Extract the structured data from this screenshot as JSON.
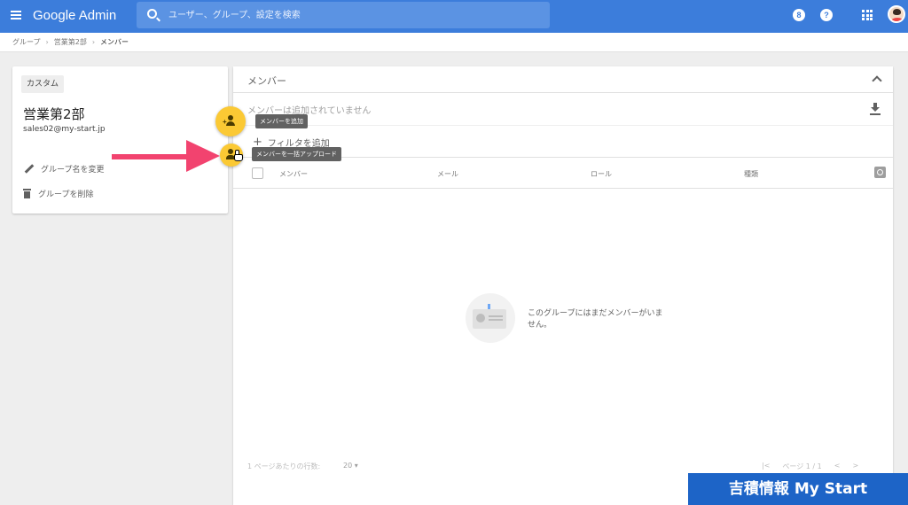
{
  "topbar": {
    "app_title": "Google Admin",
    "search_placeholder": "ユーザー、グループ、設定を検索",
    "support_badge": "8",
    "help_label": "?"
  },
  "breadcrumb": [
    "グループ",
    "営業第2部",
    "メンバー"
  ],
  "group": {
    "chip": "カスタム",
    "name": "営業第2部",
    "email": "sales02@my-start.jp",
    "rename_label": "グループ名を変更",
    "delete_label": "グループを削除"
  },
  "fabs": {
    "add_tooltip": "メンバーを追加",
    "upload_tooltip": "メンバーを一括アップロード"
  },
  "panel": {
    "title": "メンバー",
    "empty_note": "メンバーは追加されていません",
    "add_filter": "フィルタを追加",
    "columns": [
      "メンバー",
      "メール",
      "ロール",
      "種類"
    ],
    "empty_message": "このグループにはまだメンバーがいません。",
    "rows_per_page_label": "1 ページあたりの行数:",
    "rows_per_page_value": "20 ▾",
    "first_page": "|<",
    "page_label": "ページ 1 / 1",
    "prev_page": "<",
    "next_page": ">"
  },
  "watermark": "吉積情報 My Start",
  "colors": {
    "topbar": "#3c7ddb",
    "fab": "#fbc934",
    "arrow": "#f2436f",
    "watermark": "#1d64c7"
  }
}
